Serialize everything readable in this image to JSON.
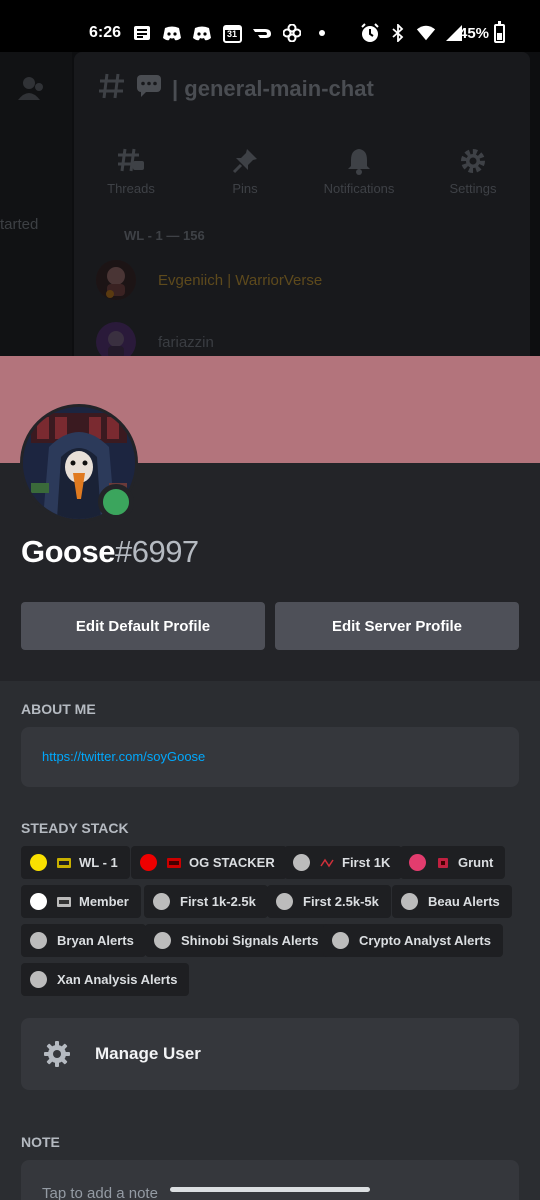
{
  "status_bar": {
    "time": "6:26",
    "battery": "45%",
    "notification_icons": [
      "news-icon",
      "discord-icon",
      "discord-icon",
      "calendar-icon",
      "doordash-icon",
      "pinwheel-icon",
      "dot-icon"
    ],
    "calendar_day": "31",
    "system_icons": [
      "alarm-icon",
      "bluetooth-icon",
      "wifi-icon",
      "signal-icon",
      "battery-icon"
    ],
    "battery_level": 0.45
  },
  "background_app": {
    "channel_name": "general-main-chat",
    "left_text": "tarted",
    "actions": [
      {
        "label": "Threads",
        "icon": "threads-icon"
      },
      {
        "label": "Pins",
        "icon": "pin-icon"
      },
      {
        "label": "Notifications",
        "icon": "bell-icon"
      },
      {
        "label": "Settings",
        "icon": "gear-icon"
      }
    ],
    "member_group": "WL - 1 — 156",
    "members": [
      {
        "name": "Evgeniich | WarriorVerse",
        "color": "#5e4a1c"
      },
      {
        "name": "fariazzin",
        "color": "#3a3d42"
      }
    ]
  },
  "profile": {
    "banner_color": "#b3747c",
    "status_color": "#3ba55d",
    "username": "Goose",
    "discriminator": "#6997",
    "edit_default_label": "Edit Default Profile",
    "edit_server_label": "Edit Server Profile",
    "about_me_title": "ABOUT ME",
    "about_me_link": "https://twitter.com/soyGoose",
    "roles_title": "STEADY STACK",
    "roles": [
      {
        "name": "WL - 1",
        "color": "#f9e000",
        "icon": "wl-badge-icon"
      },
      {
        "name": "OG STACKER",
        "color": "#ee0000",
        "icon": "og-badge-icon"
      },
      {
        "name": "First 1K",
        "color": "#bcbcbc",
        "icon": "1k-badge-icon"
      },
      {
        "name": "Grunt",
        "color": "#e23c6e",
        "icon": "grunt-badge-icon"
      },
      {
        "name": "Member",
        "color": "#ffffff",
        "icon": "member-badge-icon"
      },
      {
        "name": "First 1k-2.5k",
        "color": "#bcbcbc",
        "icon": ""
      },
      {
        "name": "First 2.5k-5k",
        "color": "#bcbcbc",
        "icon": ""
      },
      {
        "name": "Beau Alerts",
        "color": "#bcbcbc",
        "icon": ""
      },
      {
        "name": "Bryan Alerts",
        "color": "#bcbcbc",
        "icon": ""
      },
      {
        "name": "Shinobi Signals Alerts",
        "color": "#bcbcbc",
        "icon": ""
      },
      {
        "name": "Crypto Analyst Alerts",
        "color": "#bcbcbc",
        "icon": ""
      },
      {
        "name": "Xan Analysis Alerts",
        "color": "#bcbcbc",
        "icon": ""
      }
    ],
    "manage_user_label": "Manage User",
    "note_title": "NOTE",
    "note_placeholder": "Tap to add a note"
  }
}
